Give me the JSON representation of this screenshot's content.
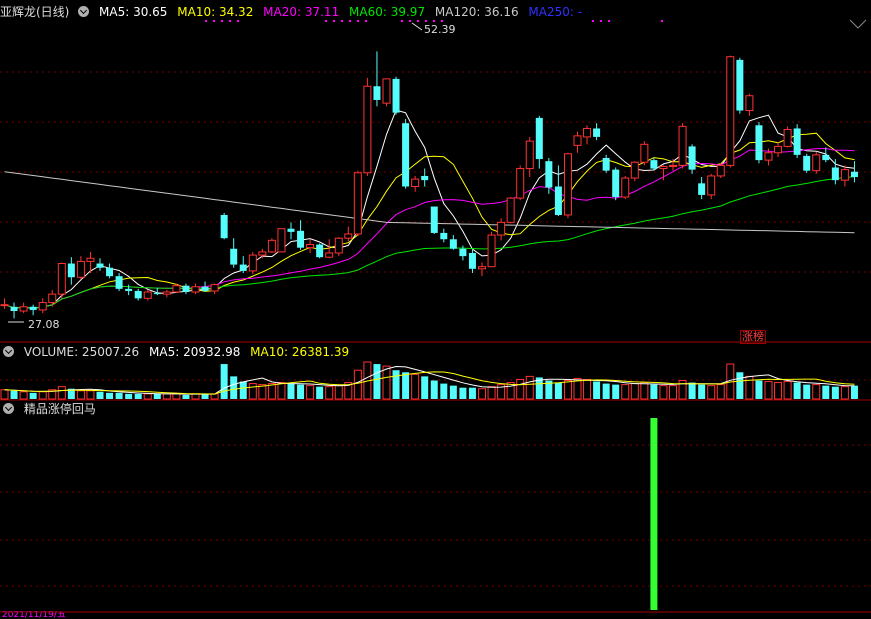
{
  "header": {
    "stock_name": "亚辉龙(日线)",
    "ma5_label": "MA5: 30.65",
    "ma10_label": "MA10: 34.32",
    "ma20_label": "MA20: 37.11",
    "ma60_label": "MA60: 39.97",
    "ma120_label": "MA120: 36.16",
    "ma250_label": "MA250: -"
  },
  "colors": {
    "up": "#ff3232",
    "down": "#54fcfc",
    "ma5": "#ffffff",
    "ma10": "#ffff00",
    "ma20": "#ff00ff",
    "ma60": "#00e600",
    "ma120": "#c8c8c8",
    "ma250": "#0000ff",
    "signal": "#33ff33"
  },
  "annotations": {
    "high": "52.39",
    "low": "27.08",
    "tag": "涨榜"
  },
  "volume_header": {
    "title": "VOLUME: 25007.26",
    "ma5": "MA5: 20932.98",
    "ma10": "MA10: 26381.39"
  },
  "indicator": {
    "title": "精品涨停回马"
  },
  "bottom_bar": {
    "date": "2021/11/19/五"
  },
  "chart_data": [
    {
      "type": "candlestick",
      "title": "亚辉龙(日线)",
      "ylim": [
        26,
        55
      ],
      "candles": [
        [
          28.4,
          29.0,
          28.0,
          28.4
        ],
        [
          28.2,
          28.6,
          27.1,
          27.8
        ],
        [
          27.8,
          28.6,
          27.6,
          28.2
        ],
        [
          28.2,
          28.4,
          27.4,
          27.9
        ],
        [
          27.9,
          29.0,
          27.6,
          28.6
        ],
        [
          28.6,
          29.8,
          28.2,
          29.4
        ],
        [
          29.4,
          32.4,
          29.0,
          32.3
        ],
        [
          32.3,
          32.9,
          30.3,
          31.0
        ],
        [
          31.0,
          33.0,
          30.8,
          32.5
        ],
        [
          32.5,
          33.4,
          31.4,
          32.8
        ],
        [
          32.3,
          32.8,
          31.6,
          31.9
        ],
        [
          31.9,
          32.3,
          30.9,
          31.1
        ],
        [
          31.1,
          31.4,
          29.7,
          29.9
        ],
        [
          29.9,
          30.3,
          29.3,
          29.7
        ],
        [
          29.7,
          29.9,
          28.8,
          29.0
        ],
        [
          29.0,
          29.8,
          28.8,
          29.6
        ],
        [
          29.5,
          30.0,
          29.3,
          29.4
        ],
        [
          29.4,
          29.8,
          29.1,
          29.6
        ],
        [
          29.6,
          30.4,
          29.5,
          30.2
        ],
        [
          30.2,
          30.4,
          29.4,
          29.6
        ],
        [
          29.6,
          30.4,
          29.4,
          30.1
        ],
        [
          30.1,
          30.6,
          29.6,
          29.7
        ],
        [
          29.7,
          30.4,
          29.4,
          30.3
        ],
        [
          36.9,
          37.1,
          34.6,
          34.7
        ],
        [
          33.7,
          34.7,
          31.9,
          32.2
        ],
        [
          32.2,
          33.0,
          31.4,
          31.6
        ],
        [
          31.6,
          33.4,
          31.3,
          33.1
        ],
        [
          33.1,
          33.7,
          32.8,
          33.4
        ],
        [
          33.4,
          34.7,
          33.3,
          34.5
        ],
        [
          33.4,
          35.6,
          33.4,
          35.6
        ],
        [
          35.6,
          36.2,
          34.6,
          35.3
        ],
        [
          35.4,
          36.4,
          33.6,
          33.8
        ],
        [
          33.8,
          34.6,
          33.3,
          34.1
        ],
        [
          34.1,
          34.2,
          32.8,
          32.9
        ],
        [
          32.9,
          34.6,
          32.8,
          33.3
        ],
        [
          33.3,
          34.8,
          33.0,
          34.7
        ],
        [
          34.7,
          35.8,
          34.4,
          35.1
        ],
        [
          35.1,
          41.1,
          34.9,
          40.9
        ],
        [
          40.9,
          49.9,
          40.6,
          49.1
        ],
        [
          49.1,
          52.4,
          47.2,
          47.8
        ],
        [
          47.5,
          49.8,
          47.2,
          49.8
        ],
        [
          49.8,
          50.0,
          46.4,
          46.6
        ],
        [
          45.6,
          46.0,
          39.4,
          39.6
        ],
        [
          39.6,
          40.6,
          39.1,
          40.3
        ],
        [
          40.6,
          41.3,
          39.6,
          40.2
        ],
        [
          37.7,
          37.7,
          35.1,
          35.2
        ],
        [
          35.2,
          35.6,
          34.3,
          34.6
        ],
        [
          34.6,
          35.0,
          33.6,
          33.7
        ],
        [
          33.7,
          34.0,
          32.6,
          33.0
        ],
        [
          33.3,
          33.6,
          31.4,
          31.8
        ],
        [
          31.8,
          32.4,
          31.1,
          32.0
        ],
        [
          32.0,
          35.3,
          32.0,
          35.0
        ],
        [
          35.0,
          36.6,
          34.5,
          36.2
        ],
        [
          36.2,
          38.6,
          36.1,
          38.5
        ],
        [
          38.5,
          41.6,
          38.3,
          41.3
        ],
        [
          41.3,
          44.3,
          40.5,
          43.9
        ],
        [
          46.1,
          46.3,
          41.3,
          42.2
        ],
        [
          42.0,
          42.3,
          38.9,
          39.5
        ],
        [
          39.6,
          41.6,
          36.8,
          36.9
        ],
        [
          36.9,
          42.8,
          36.6,
          42.7
        ],
        [
          43.5,
          44.8,
          42.8,
          44.4
        ],
        [
          44.3,
          45.4,
          43.6,
          45.1
        ],
        [
          45.1,
          45.6,
          44.0,
          44.3
        ],
        [
          42.3,
          42.6,
          40.9,
          41.1
        ],
        [
          41.2,
          41.4,
          38.3,
          38.6
        ],
        [
          38.6,
          40.6,
          38.4,
          40.4
        ],
        [
          40.4,
          42.0,
          40.1,
          41.9
        ],
        [
          41.9,
          43.9,
          41.6,
          43.6
        ],
        [
          42.1,
          42.3,
          41.1,
          41.3
        ],
        [
          41.3,
          41.6,
          40.2,
          41.5
        ],
        [
          41.5,
          42.2,
          41.1,
          41.6
        ],
        [
          41.6,
          45.6,
          41.3,
          45.3
        ],
        [
          43.4,
          43.6,
          40.8,
          41.2
        ],
        [
          39.9,
          40.5,
          38.4,
          38.8
        ],
        [
          38.8,
          40.8,
          38.4,
          40.6
        ],
        [
          40.6,
          41.8,
          40.4,
          41.6
        ],
        [
          41.6,
          52.0,
          41.4,
          51.9
        ],
        [
          51.6,
          51.8,
          46.5,
          46.8
        ],
        [
          46.8,
          48.4,
          46.3,
          48.2
        ],
        [
          45.4,
          45.7,
          41.8,
          42.1
        ],
        [
          42.1,
          43.2,
          41.6,
          42.8
        ],
        [
          42.8,
          43.8,
          42.4,
          43.4
        ],
        [
          43.4,
          45.3,
          43.3,
          45.0
        ],
        [
          45.1,
          45.5,
          42.3,
          42.6
        ],
        [
          42.5,
          42.7,
          40.9,
          41.1
        ],
        [
          41.1,
          42.9,
          40.8,
          42.6
        ],
        [
          42.6,
          43.3,
          41.9,
          42.1
        ],
        [
          41.4,
          42.2,
          39.8,
          40.2
        ],
        [
          40.2,
          41.6,
          39.6,
          41.2
        ],
        [
          41.0,
          42.0,
          40.0,
          40.5
        ]
      ],
      "ma_values": {
        "MA5": 30.65,
        "MA10": 34.32,
        "MA20": 37.11,
        "MA60": 39.97,
        "MA120": 36.16,
        "MA250": "-"
      },
      "annotations": {
        "max": 52.39,
        "min": 27.08
      }
    },
    {
      "type": "bar",
      "title": "VOLUME",
      "values": [
        9,
        8,
        7,
        6,
        7,
        9,
        12,
        10,
        8,
        8,
        7,
        6,
        6,
        5,
        5,
        5,
        5,
        5,
        5,
        4,
        5,
        5,
        5,
        34,
        22,
        17,
        15,
        14,
        15,
        16,
        15,
        14,
        13,
        12,
        12,
        13,
        16,
        28,
        36,
        34,
        32,
        28,
        26,
        24,
        22,
        18,
        15,
        13,
        11,
        11,
        10,
        12,
        14,
        16,
        19,
        22,
        21,
        18,
        16,
        18,
        20,
        19,
        17,
        15,
        14,
        14,
        15,
        16,
        14,
        13,
        13,
        18,
        16,
        14,
        13,
        14,
        34,
        26,
        22,
        18,
        17,
        16,
        17,
        16,
        14,
        14,
        13,
        12,
        12,
        13
      ],
      "ma_values": {
        "MA5": 20932.98,
        "MA10": 26381.39
      },
      "last": 25007.26
    },
    {
      "type": "bar",
      "title": "精品涨停回马",
      "signal_index": 68
    }
  ]
}
